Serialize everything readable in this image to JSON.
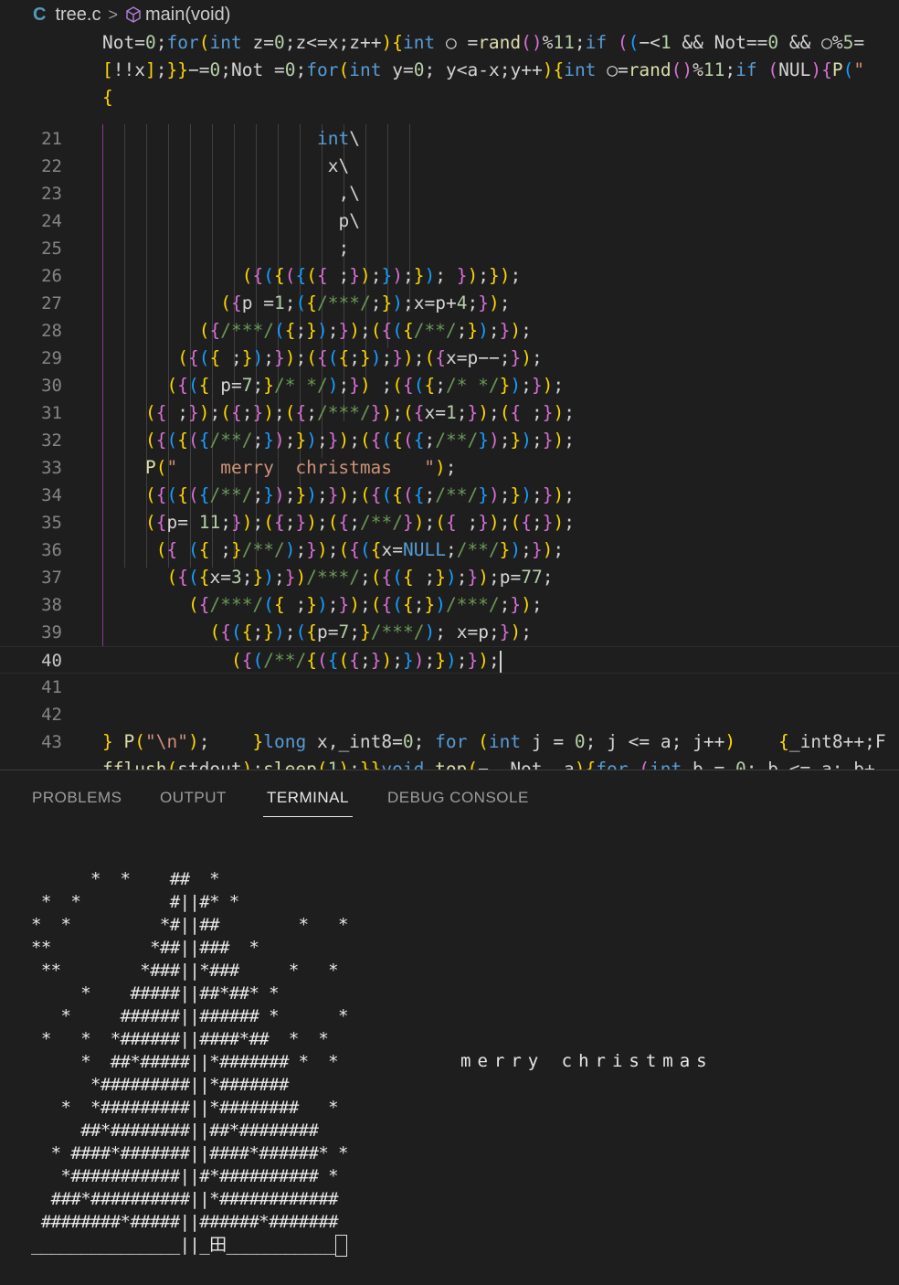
{
  "breadcrumb": {
    "file": "tree.c",
    "file_icon": "C",
    "symbol": "main(void)"
  },
  "editor": {
    "top_lines": [
      "Not=0;for(int z=0;z<=x;z++){int ○ =rand()%11;if ((−<1 && Not==0 && ○%5=",
      "[!!x];}}−=0;Not =0;for(int y=0; y<a-x;y++){int ○=rand()%11;if (NUL){P(\"",
      "{"
    ],
    "numbered_lines": [
      {
        "num": "21",
        "text": "                    int\\"
      },
      {
        "num": "22",
        "text": "                     x\\"
      },
      {
        "num": "23",
        "text": "                      ,\\"
      },
      {
        "num": "24",
        "text": "                      p\\"
      },
      {
        "num": "25",
        "text": "                      ;"
      },
      {
        "num": "26",
        "text": "             ({({({({ ;});});}); });});"
      },
      {
        "num": "27",
        "text": "           ({p =1;({/***/;});x=p+4;});"
      },
      {
        "num": "28",
        "text": "         ({/***/({;});});({({/**/;});});"
      },
      {
        "num": "29",
        "text": "       ({({ ;});});({({;});});({x=p−−;});"
      },
      {
        "num": "30",
        "text": "      ({({ p=7;}/* */);}) ;({({;/* */});});"
      },
      {
        "num": "31",
        "text": "    ({ ;});({;});({;/***/});({x=1;});({ ;});"
      },
      {
        "num": "32",
        "text": "    ({({({/**/;});});});({({({;/**/});});});"
      },
      {
        "num": "33",
        "text": "    P(\"    merry  christmas   \");"
      },
      {
        "num": "34",
        "text": "    ({({({/**/;});});});({({({;/**/});});});"
      },
      {
        "num": "35",
        "text": "    ({p= 11;});({;});({;/**/});({ ;});({;});"
      },
      {
        "num": "36",
        "text": "     ({ ({ ;}/**/);});({({x=NULL;/**/});});"
      },
      {
        "num": "37",
        "text": "      ({({x=3;});})/***/;({({ ;});});p=77;"
      },
      {
        "num": "38",
        "text": "        ({/***/({ ;});});({({;})/***/;});"
      },
      {
        "num": "39",
        "text": "          ({({;});({p=7;}/***/); x=p;});"
      },
      {
        "num": "40",
        "text": "            ({(/**/{({({;});});});});"
      },
      {
        "num": "41",
        "text": ""
      },
      {
        "num": "42",
        "text": ""
      },
      {
        "num": "43",
        "text": "} P(\"\\n\");    }long x,_int8=0; for (int j = 0; j <= a; j++)    {_int8++;F"
      }
    ],
    "bottom_line": "fflush(stdout);sleep(1);}}void top(−, Not, a){for (int b = 0; b <= a; b+"
  },
  "panel": {
    "tabs": [
      "PROBLEMS",
      "OUTPUT",
      "TERMINAL",
      "DEBUG CONSOLE"
    ],
    "active_tab": "TERMINAL"
  },
  "terminal": {
    "lines": [
      "      *  *    ##  *",
      " *  *         #||#* *",
      "*  *         *#||##        *   *",
      "**          *##||###  *",
      " **        *###||*###     *   *",
      "     *    #####||##*##* *",
      "   *     ######||###### *      *",
      " *   *  *######||####*##  *  *",
      "     *  ##*#####||*####### *  *",
      "      *#########||*#######",
      "   *  *#########||*########   *",
      "     ##*########||##*########",
      "  * ####*#######||####*######* *",
      "   *###########||#*########## *",
      "  ###*##########||*############",
      " ########*#####||######*#######",
      "_______________||_田___________"
    ],
    "message": "merry christmas"
  },
  "colors": {
    "background": "#1e1e1e",
    "keyword": "#569cd6",
    "bracket_gold": "#ffd700",
    "bracket_pink": "#da70d6",
    "bracket_blue": "#179fff",
    "string": "#ce9178",
    "number": "#b5cea8"
  }
}
